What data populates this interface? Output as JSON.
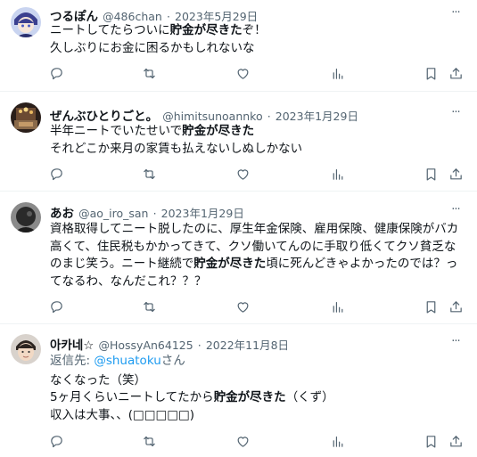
{
  "tweets": [
    {
      "display_name": "つるぽん",
      "handle": "@486chan",
      "separator": "·",
      "date": "2023年5月29日",
      "more": "···",
      "avatar_colors": [
        "#3a3f8f",
        "#c9d4f0"
      ],
      "lines": [
        [
          {
            "t": "ニートしてたらついに"
          },
          {
            "t": "貯金が尽きた",
            "b": true
          },
          {
            "t": "ぞ！"
          }
        ],
        [
          {
            "t": "久しぶりにお金に困るかもしれないな"
          }
        ]
      ]
    },
    {
      "display_name": "ぜんぶひとりごと。",
      "handle": "@himitsunoannko",
      "separator": "·",
      "date": "2023年1月29日",
      "more": "···",
      "avatar_colors": [
        "#3a2a22",
        "#e8c77c"
      ],
      "lines": [
        [
          {
            "t": "半年ニートでいたせいで"
          },
          {
            "t": "貯金が尽きた",
            "b": true
          }
        ],
        [
          {
            "t": "それどこか来月の家賃も払えないしぬしかない"
          }
        ]
      ]
    },
    {
      "display_name": "あお",
      "handle": "@ao_iro_san",
      "separator": "·",
      "date": "2023年1月29日",
      "more": "···",
      "avatar_colors": [
        "#2a2a2a",
        "#8a8a8a"
      ],
      "lines": [
        [
          {
            "t": "資格取得してニート脱したのに、厚生年金保険、雇用保険、健康保険がバカ高くて、住民税もかかってきて、クソ働いてんのに手取り低くてクソ貧乏なのまじ笑う。ニート継続で"
          },
          {
            "t": "貯金が尽きた",
            "b": true
          },
          {
            "t": "頃に死んどきゃよかったのでは？ってなるわ、なんだこれ？？？"
          }
        ]
      ]
    },
    {
      "display_name": "아카네☆",
      "handle": "@HossyAn64125",
      "separator": "·",
      "date": "2022年11月8日",
      "more": "···",
      "avatar_colors": [
        "#cfc8c0",
        "#f2e2d4"
      ],
      "reply_to_prefix": "返信先: ",
      "reply_to_mention": "@shuatoku",
      "reply_to_suffix": "さん",
      "lines": [
        [
          {
            "t": "なくなった（笑）"
          }
        ],
        [
          {
            "t": "5ヶ月くらいニートしてたから"
          },
          {
            "t": "貯金が尽きた",
            "b": true
          },
          {
            "t": "（くず）"
          }
        ],
        [
          {
            "t": "収入は大事、、(□□□□□)"
          }
        ]
      ]
    }
  ],
  "action_icons": [
    "reply-icon",
    "retweet-icon",
    "like-icon",
    "views-icon",
    "bookmark-icon",
    "share-icon"
  ],
  "colors": {
    "secondary_text": "#536471",
    "link": "#1d9bf0",
    "divider": "#eff3f4"
  }
}
